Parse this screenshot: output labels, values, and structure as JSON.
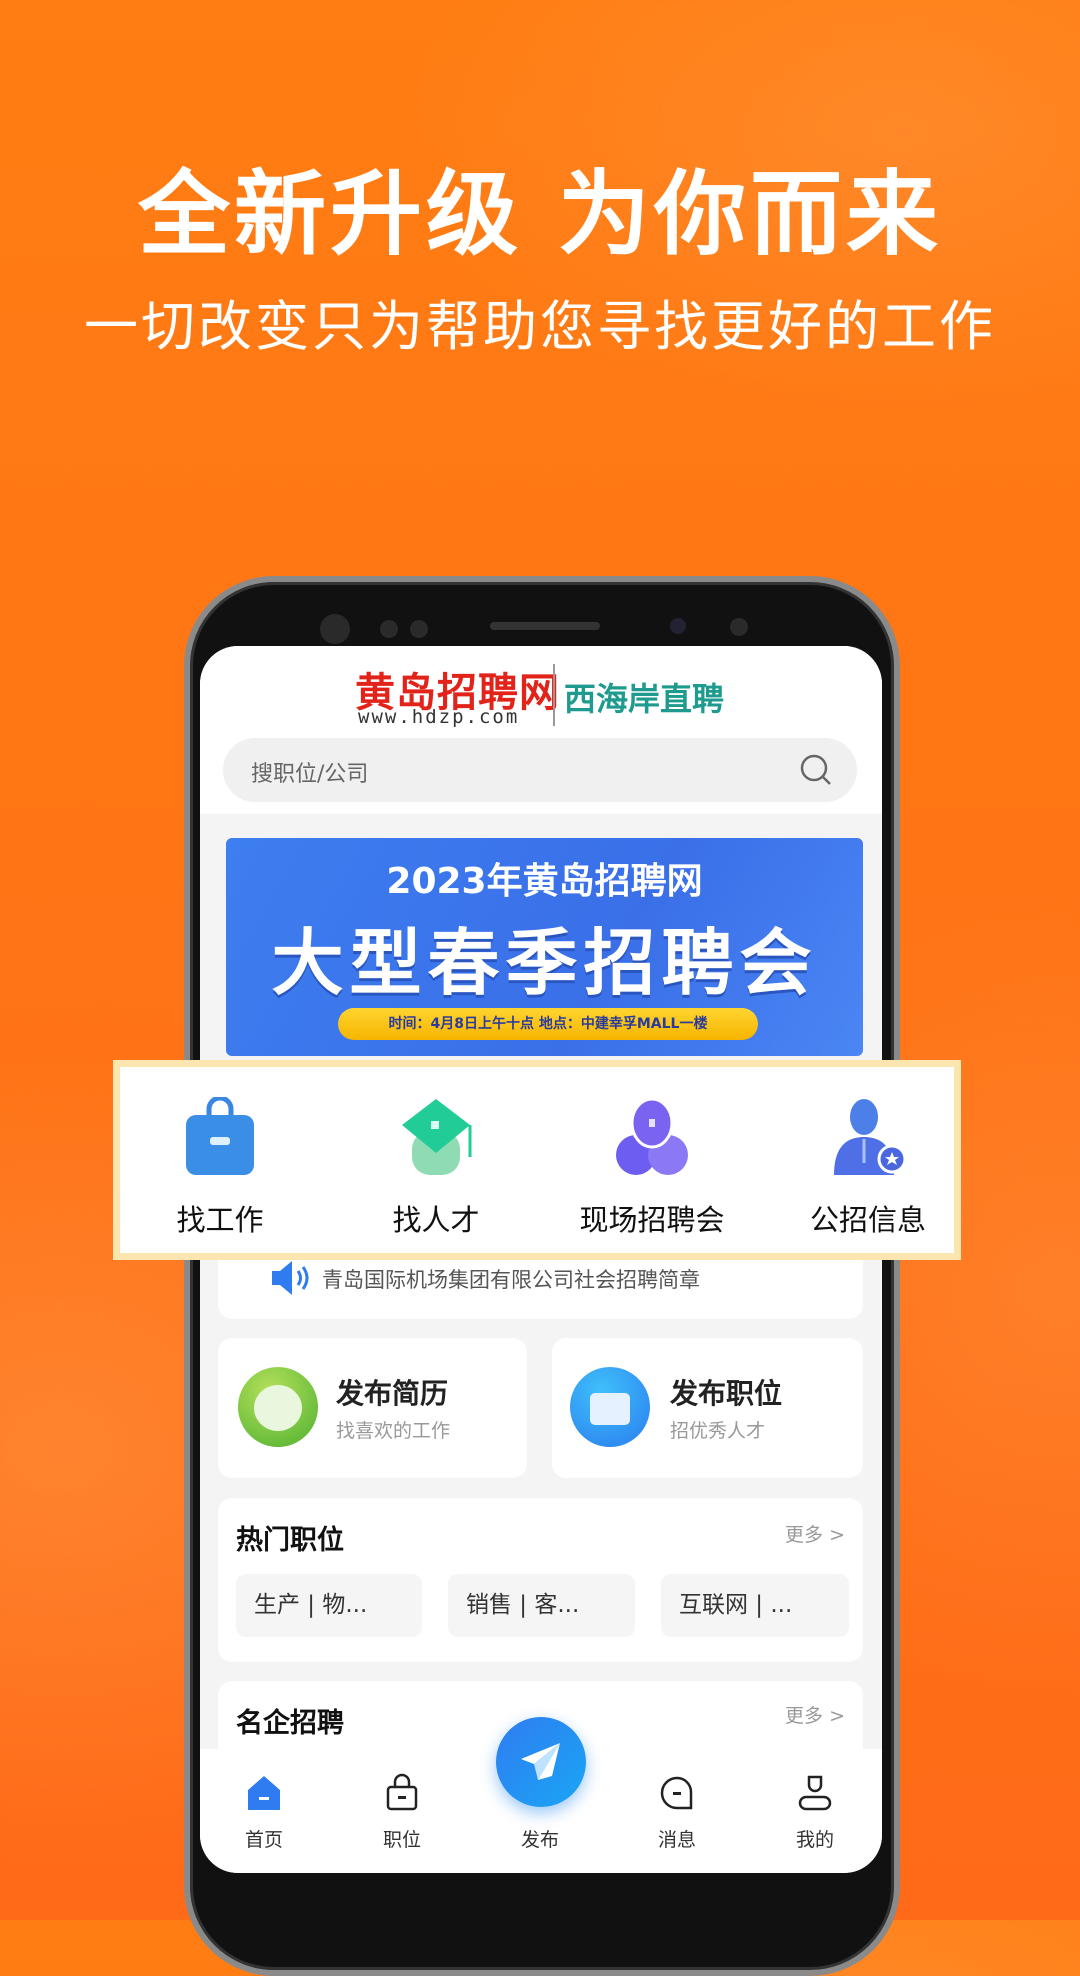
{
  "promo": {
    "headline": "全新升级 为你而来",
    "subheadline": "一切改变只为帮助您寻找更好的工作"
  },
  "app": {
    "logo": {
      "name": "黄岛招聘网",
      "url": "www.hdzp.com",
      "slogan": "西海岸直聘"
    },
    "search": {
      "placeholder": "搜职位/公司",
      "icon": "search-icon"
    },
    "banner": {
      "line1": "2023年黄岛招聘网",
      "line2": "大型春季招聘会",
      "line3": "时间：4月8日上午十点 地点：中建幸孚MALL一楼"
    },
    "quick_actions": [
      {
        "label": "找工作",
        "icon": "briefcase-icon"
      },
      {
        "label": "找人才",
        "icon": "graduation-cap-icon"
      },
      {
        "label": "现场招聘会",
        "icon": "people-group-icon"
      },
      {
        "label": "公招信息",
        "icon": "person-star-icon"
      }
    ],
    "notice": {
      "text": "青岛国际机场集团有限公司社会招聘简章",
      "icon": "speaker-icon"
    },
    "publish": [
      {
        "title": "发布简历",
        "subtitle": "找喜欢的工作",
        "icon": "mascot-icon",
        "color": "#5dc22e"
      },
      {
        "title": "发布职位",
        "subtitle": "招优秀人才",
        "icon": "briefcase-icon",
        "color": "#2f8cf0"
      }
    ],
    "hot_jobs": {
      "title": "热门职位",
      "more": "更多 >",
      "chips": [
        "生产 | 物...",
        "销售 | 客...",
        "互联网 | ..."
      ]
    },
    "famous": {
      "title": "名企招聘",
      "more": "更多 >"
    },
    "nav": [
      {
        "label": "首页",
        "icon": "home-icon",
        "active": true
      },
      {
        "label": "职位",
        "icon": "briefcase-icon"
      },
      {
        "label": "发布",
        "icon": "paper-plane-icon"
      },
      {
        "label": "消息",
        "icon": "message-icon"
      },
      {
        "label": "我的",
        "icon": "user-icon"
      }
    ],
    "colors": {
      "accent": "#2f7cf0",
      "background": "#ff7416"
    }
  }
}
